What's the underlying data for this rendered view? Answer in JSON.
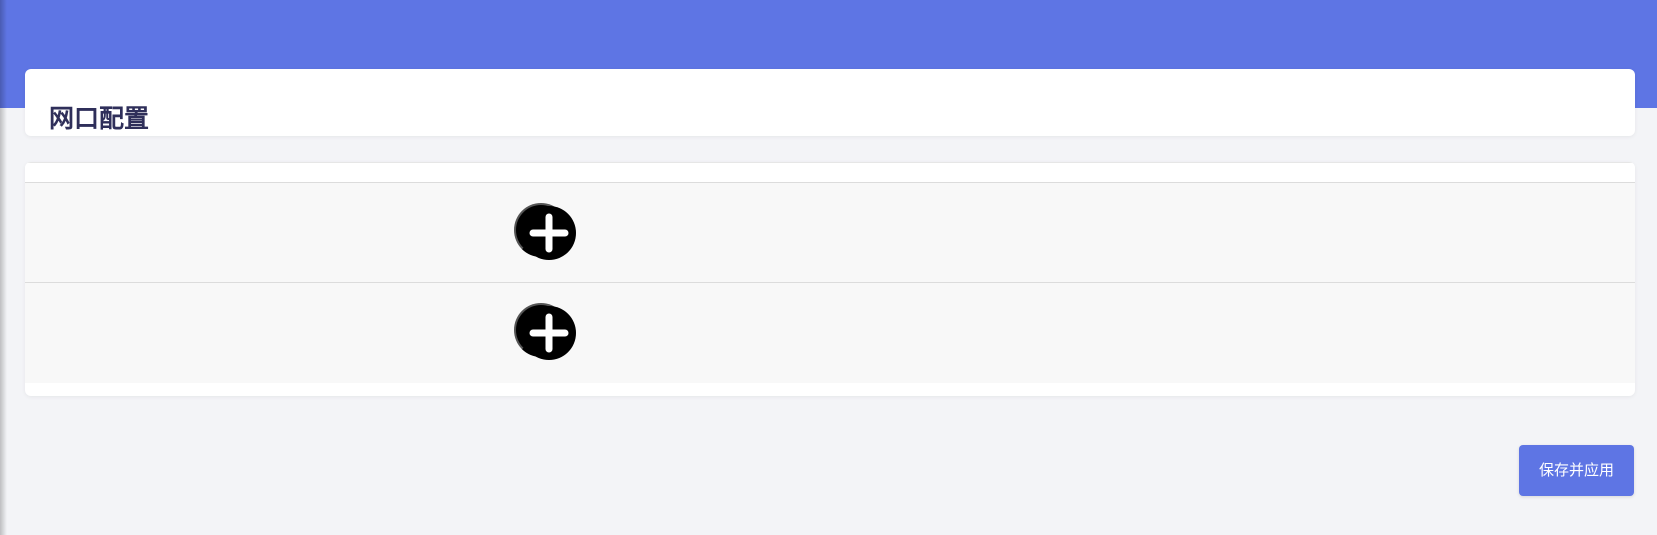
{
  "page": {
    "title": "网口配置"
  },
  "table": {
    "rows": [
      {
        "add_icon": "plus-circle-icon"
      },
      {
        "add_icon": "plus-circle-icon"
      }
    ]
  },
  "footer": {
    "save_label": "保存并应用"
  },
  "colors": {
    "accent": "#5e75e4",
    "background": "#f3f4f7",
    "card": "#ffffff",
    "row_background": "#f8f8f8",
    "title_text": "#2f2f5a",
    "icon": "#000000"
  }
}
